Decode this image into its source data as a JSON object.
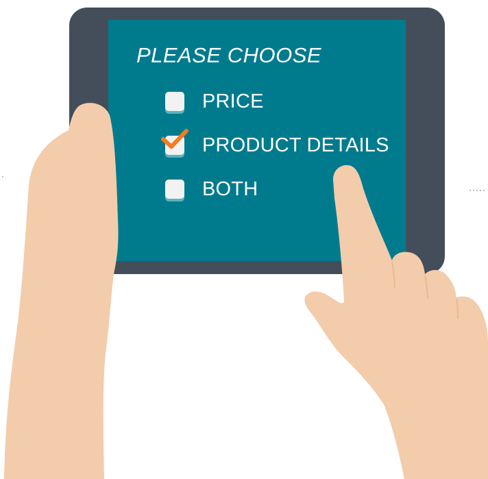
{
  "screen": {
    "title": "PLEASE CHOOSE",
    "options": [
      {
        "label": "PRICE",
        "checked": false
      },
      {
        "label": "PRODUCT DETAILS",
        "checked": true
      },
      {
        "label": "BOTH",
        "checked": false
      }
    ]
  },
  "colors": {
    "tablet_frame": "#434e5a",
    "screen": "#007b8e",
    "checkmark": "#f47b20",
    "skin": "#f3ccab",
    "checkbox": "#f2f2f2"
  },
  "icons": {
    "check": "checkmark-icon"
  }
}
